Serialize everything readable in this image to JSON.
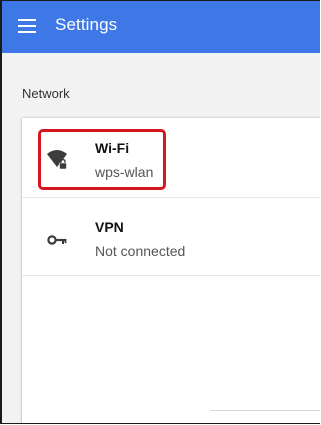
{
  "header": {
    "title": "Settings",
    "menu_icon": "hamburger-menu-icon",
    "background_color": "#3e77e6"
  },
  "network": {
    "section_label": "Network",
    "items": [
      {
        "title": "Wi-Fi",
        "subtitle": "wps-wlan",
        "icon": "wifi-locked-icon",
        "highlighted": true
      },
      {
        "title": "VPN",
        "subtitle": "Not connected",
        "icon": "key-icon",
        "highlighted": false
      }
    ]
  },
  "colors": {
    "highlight_border": "#d6161f",
    "page_background": "#f2f2f2",
    "card_background": "#ffffff"
  }
}
